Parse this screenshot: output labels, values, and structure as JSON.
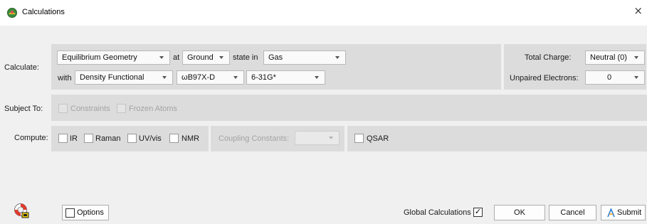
{
  "window": {
    "title": "Calculations",
    "close_glyph": "×",
    "icon": "spartan-app-icon"
  },
  "calculate": {
    "label": "Calculate:",
    "task": "Equilibrium Geometry",
    "at_text": "at",
    "state": "Ground",
    "state_in_text": "state in",
    "medium": "Gas",
    "with_text": "with",
    "method": "Density Functional",
    "functional": "ωB97X-D",
    "basis_set": "6-31G*",
    "total_charge_label": "Total Charge:",
    "total_charge": "Neutral (0)",
    "unpaired_label": "Unpaired Electrons:",
    "unpaired": "0"
  },
  "subject_to": {
    "label": "Subject To:",
    "constraints": "Constraints",
    "frozen_atoms": "Frozen Atoms"
  },
  "compute": {
    "label": "Compute:",
    "ir": "IR",
    "raman": "Raman",
    "uvvis": "UV/vis",
    "nmr": "NMR",
    "coupling_label": "Coupling Constants:",
    "coupling_value": "",
    "qsar": "QSAR"
  },
  "footer": {
    "help_icon": "lifebuoy-help-icon",
    "options": "Options",
    "global_calculations": "Global Calculations",
    "global_check_glyph": "✓",
    "ok": "OK",
    "cancel": "Cancel",
    "submit": "Submit"
  },
  "colors": {
    "panel": "#dcdcdc",
    "background": "#f0f0f0",
    "submit_icon": "#2a7fd4"
  }
}
